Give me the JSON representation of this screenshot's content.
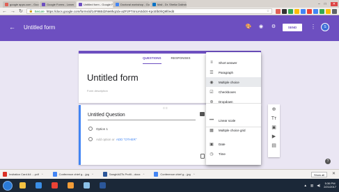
{
  "browser": {
    "tabs": [
      {
        "label": "google apps.com - Goo",
        "color": "#e06055"
      },
      {
        "label": "Google Forms - Learn",
        "color": "#6d4fc0"
      },
      {
        "label": "Untitled form - Google F",
        "color": "#6d4fc0",
        "active": true
      },
      {
        "label": "Doctoral workshop - Goo",
        "color": "#4285f4"
      },
      {
        "label": "Mail - Dr. Shelia Galindo",
        "color": "#0072c6"
      }
    ],
    "secure_label": "Secure",
    "url": "https://docs.google.com/forms/d/14F86Ed2Ne8hqzdx-aZF2PT4nUA0d4X-KpcElb0hQ9ft/edit",
    "extension_colors": [
      "#e06055",
      "#333333",
      "#34a853",
      "#fbbc05",
      "#4285f4",
      "#ea4335",
      "#4285f4",
      "#34a853",
      "#fbbc05",
      "#5f6368"
    ]
  },
  "form": {
    "window_title": "Untitled form",
    "send_label": "SEND",
    "avatar_initial": "S",
    "accent_color": "#6d4fc0",
    "tabs": {
      "questions": "QUESTIONS",
      "responses": "RESPONSES"
    },
    "title": "Untitled form",
    "description_placeholder": "Form description",
    "question": {
      "title": "Untitled Question",
      "option1": "Option 1",
      "add_option": "Add option",
      "or_label": "or",
      "add_other": "ADD \"OTHER\""
    }
  },
  "type_menu": {
    "items": [
      {
        "label": "Short answer",
        "icon": "short-answer-icon",
        "glyph": "≡"
      },
      {
        "label": "Paragraph",
        "icon": "paragraph-icon",
        "glyph": "☰"
      },
      {
        "label": "Multiple choice",
        "icon": "radio-button-icon",
        "glyph": "◉",
        "selected": true
      },
      {
        "label": "Checkboxes",
        "icon": "checkbox-icon",
        "glyph": "☑"
      },
      {
        "label": "Dropdown",
        "icon": "dropdown-icon",
        "glyph": "⊛"
      },
      {
        "label": "Linear scale",
        "icon": "linear-scale-icon",
        "glyph": "•••"
      },
      {
        "label": "Multiple choice grid",
        "icon": "grid-icon",
        "glyph": "▦"
      },
      {
        "label": "Date",
        "icon": "calendar-icon",
        "glyph": "▣"
      },
      {
        "label": "Time",
        "icon": "clock-icon",
        "glyph": "◷"
      }
    ]
  },
  "downloads": {
    "items": [
      {
        "label": "Invitation Card A4 ....pdf",
        "color": "#d93025"
      },
      {
        "label": "Conference chief g....jpg",
        "color": "#4285f4"
      },
      {
        "label": "SanghAiZTs Profil....docx",
        "color": "#2b579a"
      },
      {
        "label": "Conference chief g....jpg",
        "color": "#4285f4"
      }
    ],
    "show_all_label": "Show all"
  },
  "taskbar": {
    "apps": [
      {
        "name": "file-explorer",
        "color": "#f5c242"
      },
      {
        "name": "internet-explorer",
        "color": "#3a8ee6"
      },
      {
        "name": "chrome",
        "color": "#ea4335"
      },
      {
        "name": "media-player",
        "color": "#f29d38"
      },
      {
        "name": "photos",
        "color": "#8bc1e8"
      },
      {
        "name": "word",
        "color": "#2b579a"
      }
    ],
    "time": "5:36 PM",
    "date": "2/21/2017"
  }
}
